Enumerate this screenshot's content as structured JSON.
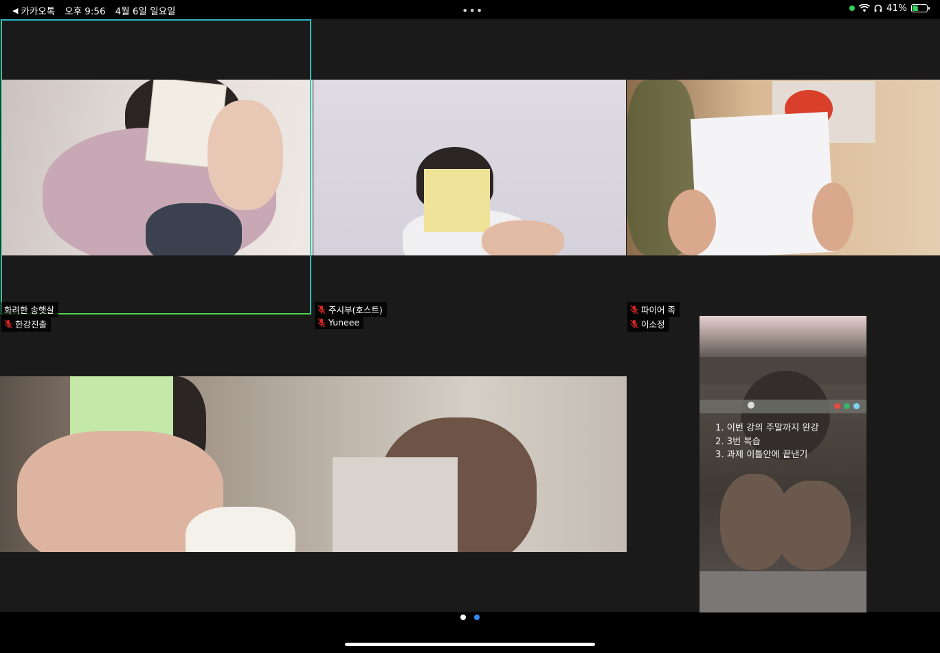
{
  "status_bar": {
    "back_app": "카카오톡",
    "time": "오후 9:56",
    "date": "4월 6일 일요일",
    "battery": "41%",
    "battery_level": 0.41,
    "colors": {
      "battery": "#2fd158",
      "indicator": "#2fd158"
    }
  },
  "participants": [
    {
      "name": "화려한 송햇살",
      "muted": false,
      "active_speaker": true
    },
    {
      "name": "한강진출",
      "muted": true
    },
    {
      "name": "주시부(호스트)",
      "muted": true
    },
    {
      "name": "Yuneee",
      "muted": true
    },
    {
      "name": "파이어 족",
      "muted": true
    },
    {
      "name": "이소정",
      "muted": true
    }
  ],
  "screen_note": {
    "lines": [
      "1. 이번 강의 주말까지 완강",
      "2. 3번 복습",
      "3. 과제 이틀안에 끝낸기"
    ]
  },
  "pager": {
    "total": 2,
    "current": 2
  },
  "colors": {
    "active_border": "#2fb8c6",
    "mic_muted": "#e02424",
    "pager_active": "#2f8cff"
  }
}
